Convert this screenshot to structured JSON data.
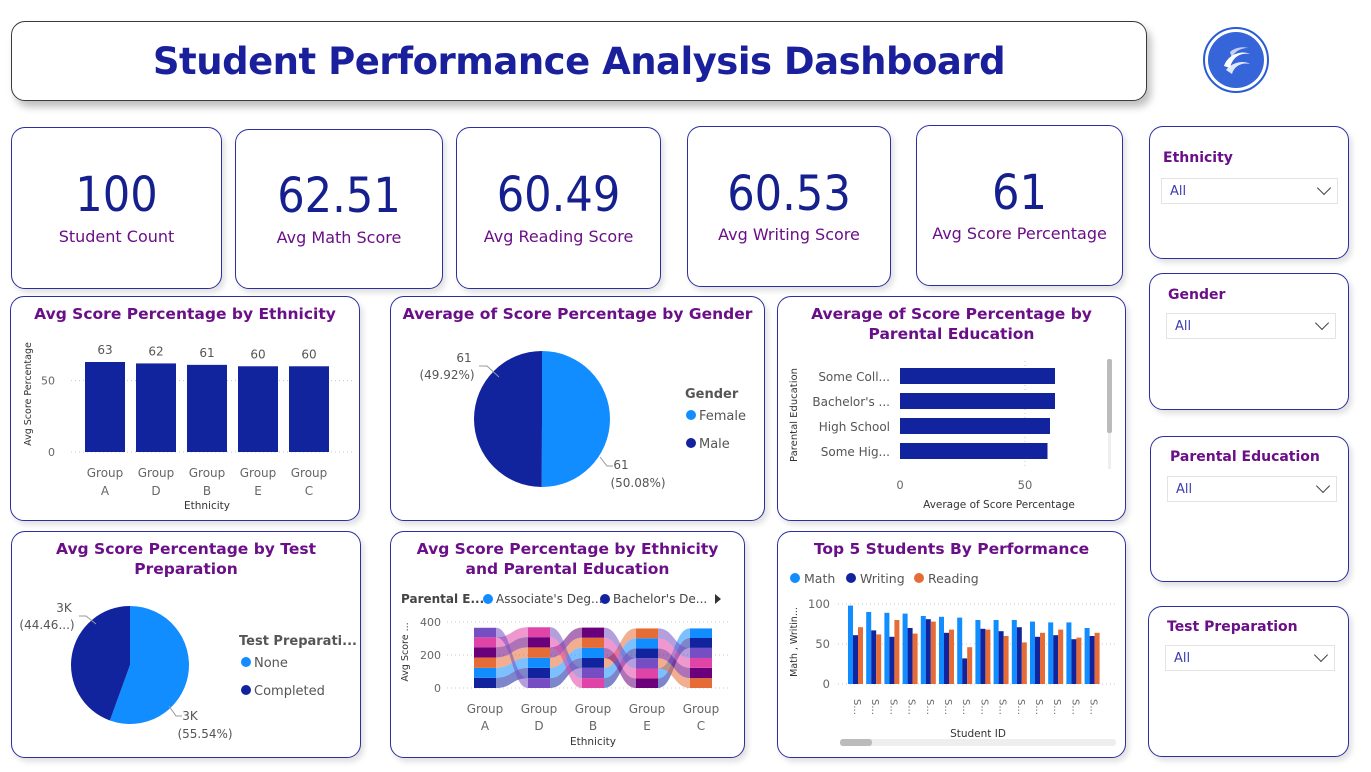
{
  "header": {
    "title": "Student Performance Analysis Dashboard"
  },
  "kpis": [
    {
      "value": "100",
      "label": "Student Count"
    },
    {
      "value": "62.51",
      "label": "Avg Math Score"
    },
    {
      "value": "60.49",
      "label": "Avg Reading Score"
    },
    {
      "value": "60.53",
      "label": "Avg Writing Score"
    },
    {
      "value": "61",
      "label": "Avg Score Percentage"
    }
  ],
  "slicers": [
    {
      "title": "Ethnicity",
      "value": "All"
    },
    {
      "title": "Gender",
      "value": "All"
    },
    {
      "title": "Parental Education",
      "value": "All"
    },
    {
      "title": "Test Preparation",
      "value": "All"
    }
  ],
  "colors": {
    "navy": "#12239e",
    "blue": "#118dff",
    "orange": "#e66c37",
    "purple": "#6b007b",
    "pink": "#e044a7",
    "violet": "#744ec2"
  },
  "chart_data": [
    {
      "type": "bar",
      "title": "Avg Score Percentage by Ethnicity",
      "xlabel": "Ethnicity",
      "ylabel": "Avg Score Percentage",
      "categories": [
        [
          "Group",
          "A"
        ],
        [
          "Group",
          "D"
        ],
        [
          "Group",
          "B"
        ],
        [
          "Group",
          "E"
        ],
        [
          "Group",
          "C"
        ]
      ],
      "values": [
        63,
        62,
        61,
        60,
        60
      ],
      "data_labels": [
        "63",
        "62",
        "61",
        "60",
        "60"
      ],
      "y_ticks": [
        "0",
        "50"
      ],
      "ylim": [
        0,
        70
      ],
      "grid": true
    },
    {
      "type": "pie",
      "title": "Average of Score Percentage by Gender",
      "legend_title": "Gender",
      "legend_position": "right",
      "slices": [
        {
          "name": "Female",
          "value": 61,
          "percent": 50.08,
          "label_value": "61",
          "label_pct": "(50.08%)"
        },
        {
          "name": "Male",
          "value": 61,
          "percent": 49.92,
          "label_value": "61",
          "label_pct": "(49.92%)"
        }
      ]
    },
    {
      "type": "bar",
      "orientation": "horizontal",
      "title": "Average of Score Percentage by Parental Education",
      "xlabel": "Average of Score Percentage",
      "ylabel": "Parental Education",
      "categories": [
        "Some Coll...",
        "Bachelor's ...",
        "High School",
        "Some Hig..."
      ],
      "values": [
        62,
        62,
        60,
        59
      ],
      "x_ticks": [
        "0",
        "50"
      ],
      "xlim": [
        0,
        80
      ]
    },
    {
      "type": "pie",
      "title": "Avg Score Percentage by Test Preparation",
      "legend_title": "Test Preparati...",
      "legend_position": "right",
      "slices": [
        {
          "name": "None",
          "value": 3,
          "percent": 55.54,
          "label_value": "3K",
          "label_pct": "(55.54%)"
        },
        {
          "name": "Completed",
          "value": 3,
          "percent": 44.46,
          "label_value": "3K",
          "label_pct": "(44.46...)"
        }
      ]
    },
    {
      "type": "bar",
      "stacked": true,
      "title": "Avg Score Percentage by Ethnicity and Parental Education",
      "legend_title": "Parental E...",
      "legend_items": [
        "Associate's Deg...",
        "Bachelor's De..."
      ],
      "xlabel": "Ethnicity",
      "ylabel": "Avg Score ...",
      "categories": [
        [
          "Group",
          "A"
        ],
        [
          "Group",
          "D"
        ],
        [
          "Group",
          "B"
        ],
        [
          "Group",
          "E"
        ],
        [
          "Group",
          "C"
        ]
      ],
      "y_ticks": [
        "0",
        "200",
        "400"
      ],
      "ylim": [
        0,
        420
      ],
      "series": [
        {
          "values": [
            62,
            60,
            60,
            58,
            60
          ]
        },
        {
          "values": [
            60,
            62,
            62,
            60,
            62
          ]
        },
        {
          "values": [
            63,
            61,
            60,
            62,
            60
          ]
        },
        {
          "values": [
            62,
            63,
            61,
            60,
            61
          ]
        },
        {
          "values": [
            60,
            62,
            62,
            61,
            60
          ]
        },
        {
          "values": [
            58,
            60,
            61,
            60,
            58
          ]
        }
      ]
    },
    {
      "type": "bar",
      "title": "Top 5 Students By Performance",
      "legend_items": [
        "Math",
        "Writing",
        "Reading"
      ],
      "legend_position": "top-left",
      "xlabel": "Student ID",
      "ylabel": "Math , Writin...",
      "categories": [
        "S...",
        "S...",
        "S...",
        "S...",
        "S...",
        "S...",
        "S...",
        "S...",
        "S...",
        "S...",
        "S...",
        "S...",
        "S...",
        "S..."
      ],
      "y_ticks": [
        "0",
        "50",
        "100"
      ],
      "ylim": [
        0,
        105
      ],
      "series": [
        {
          "name": "Math",
          "values": [
            98,
            90,
            89,
            88,
            85,
            84,
            83,
            80,
            80,
            80,
            78,
            77,
            77,
            70
          ]
        },
        {
          "name": "Writing",
          "values": [
            61,
            67,
            59,
            70,
            81,
            64,
            32,
            69,
            66,
            71,
            59,
            61,
            56,
            60
          ]
        },
        {
          "name": "Reading",
          "values": [
            71,
            62,
            80,
            63,
            78,
            68,
            46,
            68,
            60,
            52,
            64,
            68,
            58,
            64
          ]
        }
      ]
    }
  ]
}
